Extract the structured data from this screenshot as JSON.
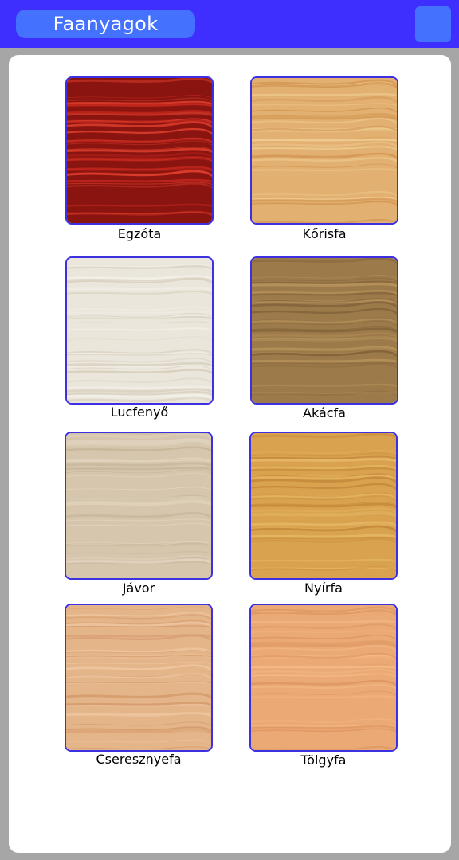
{
  "header": {
    "title": "Faanyagok",
    "menu_icon": "menu-button",
    "bar_color": "#3f2fff",
    "accent_color": "#4472ff"
  },
  "woods": [
    {
      "id": "egzota",
      "label": "Egzóta",
      "colors": [
        "#8a1410",
        "#c8291e",
        "#e0402e"
      ]
    },
    {
      "id": "korisfa",
      "label": "Kőrisfa",
      "colors": [
        "#e2b070",
        "#f1cf96",
        "#d29450"
      ]
    },
    {
      "id": "lucfenyo",
      "label": "Lucfenyő",
      "colors": [
        "#ebe6dc",
        "#f4f1ea",
        "#d8cfbd"
      ]
    },
    {
      "id": "akacfa",
      "label": "Akácfa",
      "colors": [
        "#9d7a49",
        "#b8935c",
        "#82623a"
      ]
    },
    {
      "id": "javor",
      "label": "Jávor",
      "colors": [
        "#d6c6ae",
        "#e4d7c3",
        "#c5b397"
      ]
    },
    {
      "id": "nyirfa",
      "label": "Nyírfa",
      "colors": [
        "#d9a24e",
        "#e6b968",
        "#c4883a"
      ]
    },
    {
      "id": "cseresznyefa",
      "label": "Cseresznyefa",
      "colors": [
        "#e5b58a",
        "#f0cba6",
        "#d49a6b"
      ]
    },
    {
      "id": "tolgyfa",
      "label": "Tölgyfa",
      "colors": [
        "#eba975",
        "#f5bb8a",
        "#dd955f"
      ]
    }
  ]
}
